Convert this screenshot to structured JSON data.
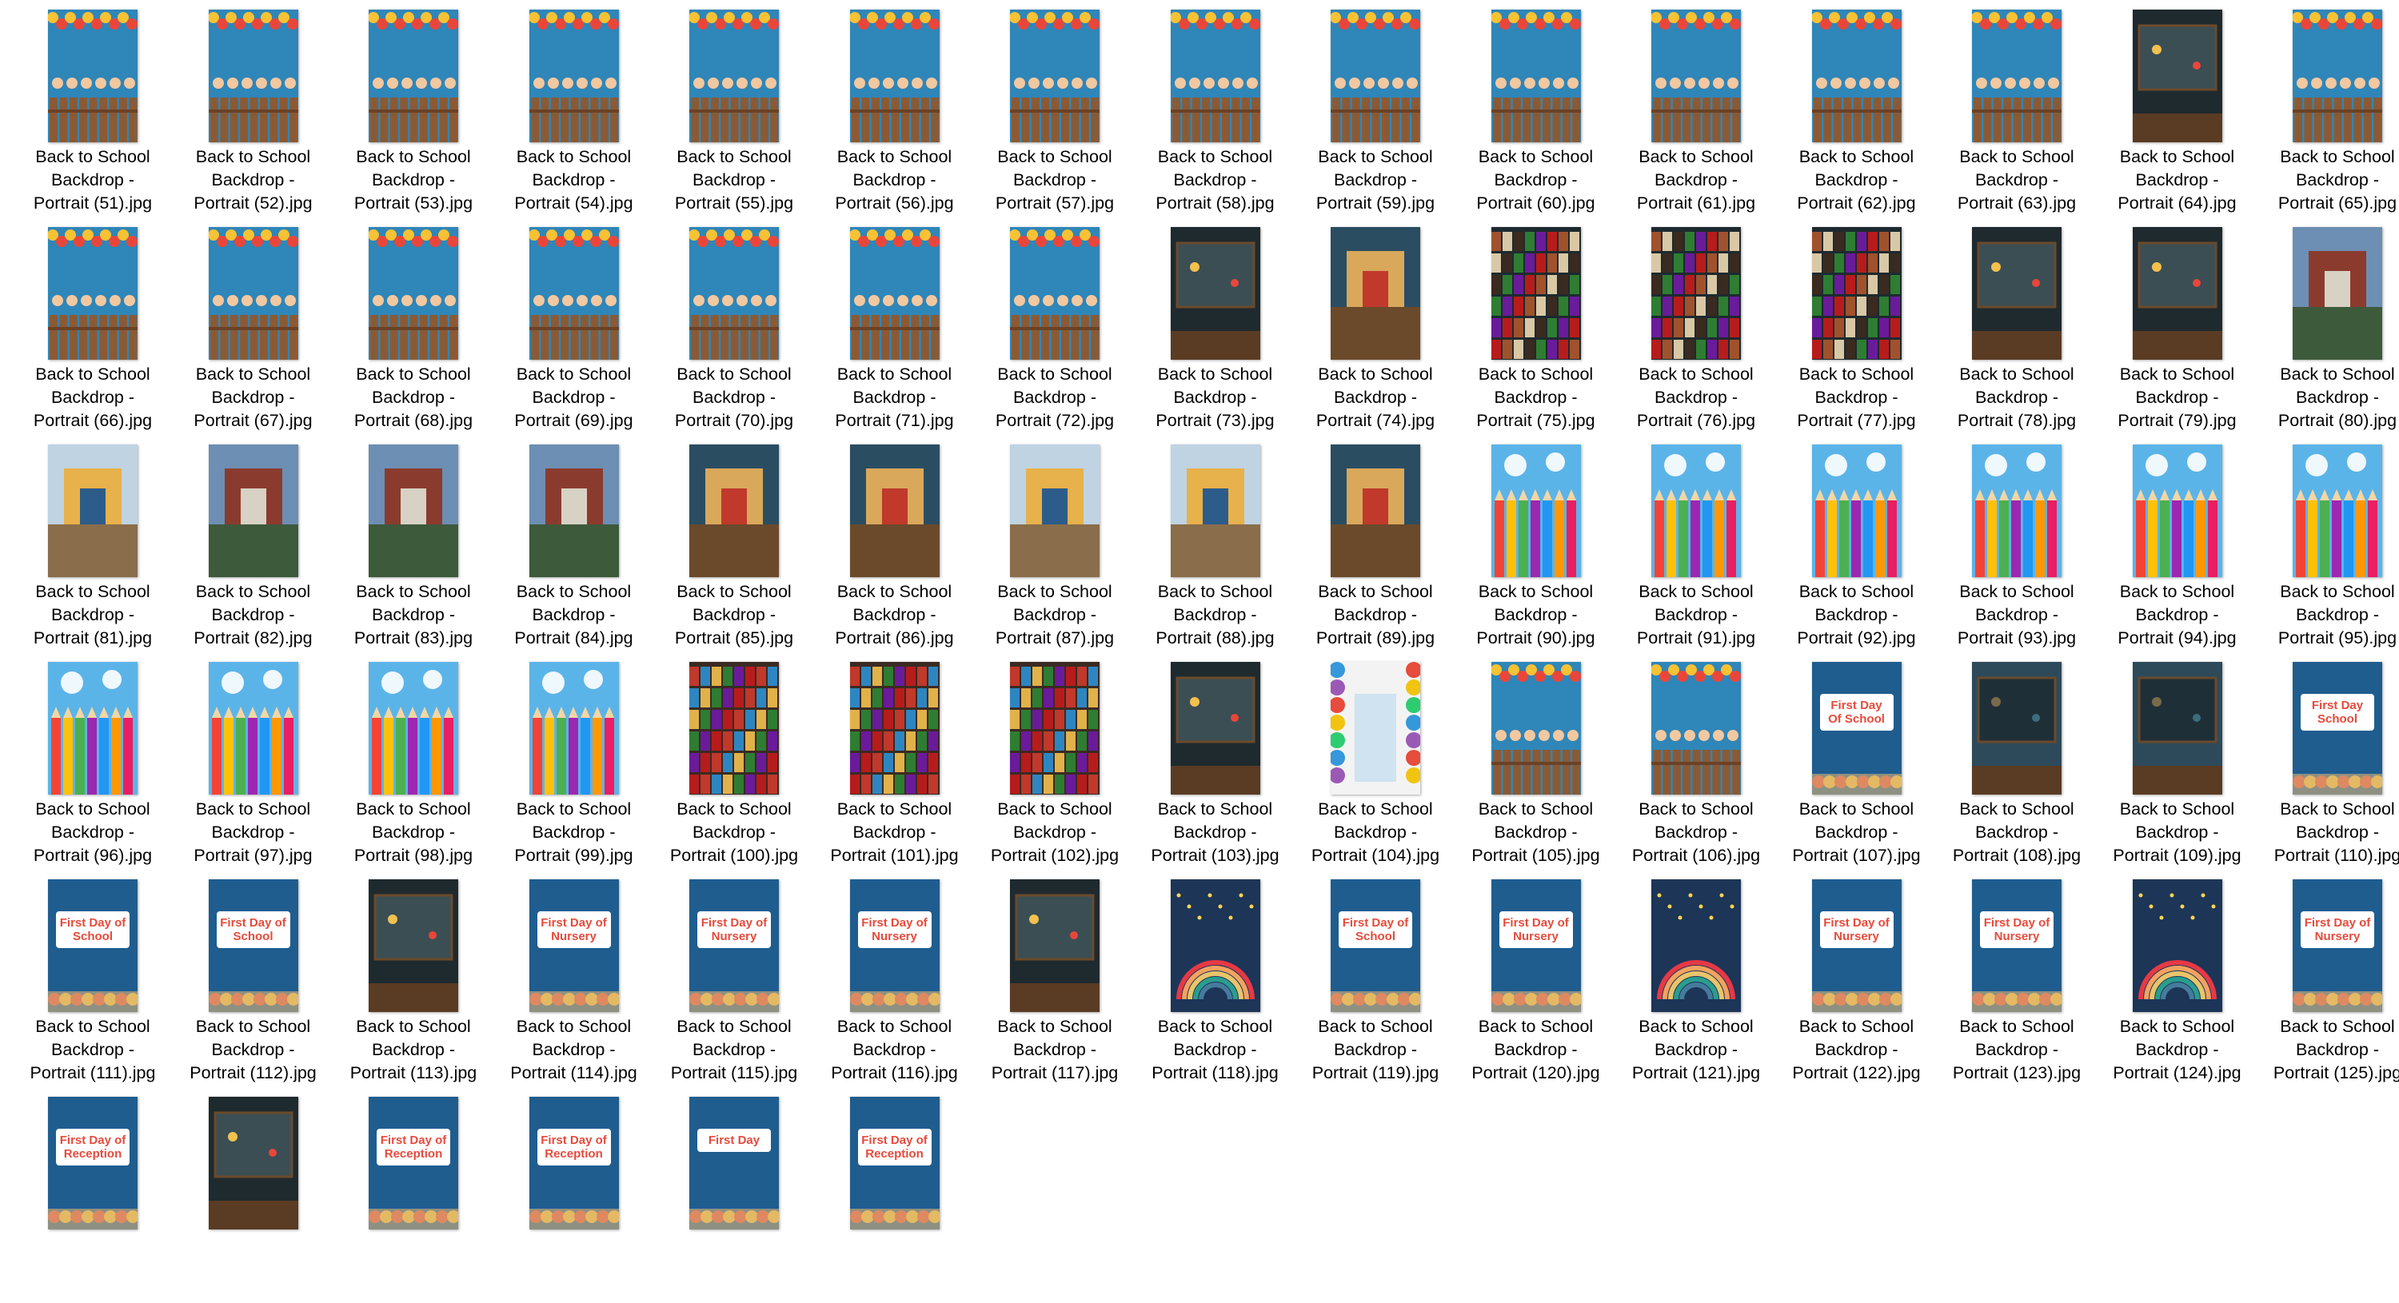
{
  "explorer": {
    "view": "large-icons"
  },
  "files": [
    {
      "label": "Back to School\nBackdrop -\nPortrait (51).jpg",
      "theme": "fence"
    },
    {
      "label": "Back to School\nBackdrop -\nPortrait (52).jpg",
      "theme": "fence"
    },
    {
      "label": "Back to School\nBackdrop -\nPortrait (53).jpg",
      "theme": "fence"
    },
    {
      "label": "Back to School\nBackdrop -\nPortrait (54).jpg",
      "theme": "fence"
    },
    {
      "label": "Back to School\nBackdrop -\nPortrait (55).jpg",
      "theme": "fence"
    },
    {
      "label": "Back to School\nBackdrop -\nPortrait (56).jpg",
      "theme": "fence"
    },
    {
      "label": "Back to School\nBackdrop -\nPortrait (57).jpg",
      "theme": "fence"
    },
    {
      "label": "Back to School\nBackdrop -\nPortrait (58).jpg",
      "theme": "fence"
    },
    {
      "label": "Back to School\nBackdrop -\nPortrait (59).jpg",
      "theme": "fence"
    },
    {
      "label": "Back to School\nBackdrop -\nPortrait (60).jpg",
      "theme": "fence"
    },
    {
      "label": "Back to School\nBackdrop -\nPortrait (61).jpg",
      "theme": "fence"
    },
    {
      "label": "Back to School\nBackdrop -\nPortrait (62).jpg",
      "theme": "fence"
    },
    {
      "label": "Back to School\nBackdrop -\nPortrait (63).jpg",
      "theme": "fence"
    },
    {
      "label": "Back to School\nBackdrop -\nPortrait (64).jpg",
      "theme": "chalkboard"
    },
    {
      "label": "Back to School\nBackdrop -\nPortrait (65).jpg",
      "theme": "fence"
    },
    {
      "label": "Back to School\nBackdrop -\nPortrait (66).jpg",
      "theme": "fence"
    },
    {
      "label": "Back to School\nBackdrop -\nPortrait (67).jpg",
      "theme": "fence"
    },
    {
      "label": "Back to School\nBackdrop -\nPortrait (68).jpg",
      "theme": "fence"
    },
    {
      "label": "Back to School\nBackdrop -\nPortrait (69).jpg",
      "theme": "fence"
    },
    {
      "label": "Back to School\nBackdrop -\nPortrait (70).jpg",
      "theme": "fence"
    },
    {
      "label": "Back to School\nBackdrop -\nPortrait (71).jpg",
      "theme": "fence"
    },
    {
      "label": "Back to School\nBackdrop -\nPortrait (72).jpg",
      "theme": "fence"
    },
    {
      "label": "Back to School\nBackdrop -\nPortrait (73).jpg",
      "theme": "chalkboard"
    },
    {
      "label": "Back to School\nBackdrop -\nPortrait (74).jpg",
      "theme": "classroom"
    },
    {
      "label": "Back to School\nBackdrop -\nPortrait (75).jpg",
      "theme": "books-dark"
    },
    {
      "label": "Back to School\nBackdrop -\nPortrait (76).jpg",
      "theme": "books-dark"
    },
    {
      "label": "Back to School\nBackdrop -\nPortrait (77).jpg",
      "theme": "books-dark"
    },
    {
      "label": "Back to School\nBackdrop -\nPortrait (78).jpg",
      "theme": "chalkboard"
    },
    {
      "label": "Back to School\nBackdrop -\nPortrait (79).jpg",
      "theme": "chalkboard"
    },
    {
      "label": "Back to School\nBackdrop -\nPortrait (80).jpg",
      "theme": "building"
    },
    {
      "label": "Back to School\nBackdrop -\nPortrait (81).jpg",
      "theme": "hallway"
    },
    {
      "label": "Back to School\nBackdrop -\nPortrait (82).jpg",
      "theme": "building"
    },
    {
      "label": "Back to School\nBackdrop -\nPortrait (83).jpg",
      "theme": "building"
    },
    {
      "label": "Back to School\nBackdrop -\nPortrait (84).jpg",
      "theme": "building"
    },
    {
      "label": "Back to School\nBackdrop -\nPortrait (85).jpg",
      "theme": "classroom"
    },
    {
      "label": "Back to School\nBackdrop -\nPortrait (86).jpg",
      "theme": "classroom"
    },
    {
      "label": "Back to School\nBackdrop -\nPortrait (87).jpg",
      "theme": "hallway"
    },
    {
      "label": "Back to School\nBackdrop -\nPortrait (88).jpg",
      "theme": "hallway"
    },
    {
      "label": "Back to School\nBackdrop -\nPortrait (89).jpg",
      "theme": "classroom"
    },
    {
      "label": "Back to School\nBackdrop -\nPortrait (90).jpg",
      "theme": "pencils"
    },
    {
      "label": "Back to School\nBackdrop -\nPortrait (91).jpg",
      "theme": "pencils"
    },
    {
      "label": "Back to School\nBackdrop -\nPortrait (92).jpg",
      "theme": "pencils"
    },
    {
      "label": "Back to School\nBackdrop -\nPortrait (93).jpg",
      "theme": "pencils"
    },
    {
      "label": "Back to School\nBackdrop -\nPortrait (94).jpg",
      "theme": "pencils"
    },
    {
      "label": "Back to School\nBackdrop -\nPortrait (95).jpg",
      "theme": "pencils"
    },
    {
      "label": "Back to School\nBackdrop -\nPortrait (96).jpg",
      "theme": "pencils"
    },
    {
      "label": "Back to School\nBackdrop -\nPortrait (97).jpg",
      "theme": "pencils"
    },
    {
      "label": "Back to School\nBackdrop -\nPortrait (98).jpg",
      "theme": "pencils"
    },
    {
      "label": "Back to School\nBackdrop -\nPortrait (99).jpg",
      "theme": "pencils"
    },
    {
      "label": "Back to School\nBackdrop -\nPortrait (100).jpg",
      "theme": "books"
    },
    {
      "label": "Back to School\nBackdrop -\nPortrait (101).jpg",
      "theme": "books"
    },
    {
      "label": "Back to School\nBackdrop -\nPortrait (102).jpg",
      "theme": "books"
    },
    {
      "label": "Back to School\nBackdrop -\nPortrait (103).jpg",
      "theme": "chalkboard"
    },
    {
      "label": "Back to School\nBackdrop -\nPortrait (104).jpg",
      "theme": "balloons"
    },
    {
      "label": "Back to School\nBackdrop -\nPortrait (105).jpg",
      "theme": "fence"
    },
    {
      "label": "Back to School\nBackdrop -\nPortrait (106).jpg",
      "theme": "fence"
    },
    {
      "label": "Back to School\nBackdrop -\nPortrait (107).jpg",
      "theme": "sign",
      "text": "First Day Of School"
    },
    {
      "label": "Back to School\nBackdrop -\nPortrait (108).jpg",
      "theme": "map"
    },
    {
      "label": "Back to School\nBackdrop -\nPortrait (109).jpg",
      "theme": "map"
    },
    {
      "label": "Back to School\nBackdrop -\nPortrait (110).jpg",
      "theme": "sign",
      "text": "First Day School"
    },
    {
      "label": "Back to School\nBackdrop -\nPortrait (111).jpg",
      "theme": "sign",
      "text": "First Day of School"
    },
    {
      "label": "Back to School\nBackdrop -\nPortrait (112).jpg",
      "theme": "sign",
      "text": "First Day of School"
    },
    {
      "label": "Back to School\nBackdrop -\nPortrait (113).jpg",
      "theme": "chalkboard"
    },
    {
      "label": "Back to School\nBackdrop -\nPortrait (114).jpg",
      "theme": "sign",
      "text": "First Day of Nursery"
    },
    {
      "label": "Back to School\nBackdrop -\nPortrait (115).jpg",
      "theme": "sign",
      "text": "First Day of Nursery"
    },
    {
      "label": "Back to School\nBackdrop -\nPortrait (116).jpg",
      "theme": "sign",
      "text": "First Day of Nursery"
    },
    {
      "label": "Back to School\nBackdrop -\nPortrait (117).jpg",
      "theme": "chalkboard"
    },
    {
      "label": "Back to School\nBackdrop -\nPortrait (118).jpg",
      "theme": "rainbow"
    },
    {
      "label": "Back to School\nBackdrop -\nPortrait (119).jpg",
      "theme": "sign",
      "text": "First Day of School"
    },
    {
      "label": "Back to School\nBackdrop -\nPortrait (120).jpg",
      "theme": "sign",
      "text": "First Day of Nursery"
    },
    {
      "label": "Back to School\nBackdrop -\nPortrait (121).jpg",
      "theme": "rainbow"
    },
    {
      "label": "Back to School\nBackdrop -\nPortrait (122).jpg",
      "theme": "sign",
      "text": "First Day of Nursery"
    },
    {
      "label": "Back to School\nBackdrop -\nPortrait (123).jpg",
      "theme": "sign",
      "text": "First Day of Nursery"
    },
    {
      "label": "Back to School\nBackdrop -\nPortrait (124).jpg",
      "theme": "rainbow"
    },
    {
      "label": "Back to School\nBackdrop -\nPortrait (125).jpg",
      "theme": "sign",
      "text": "First Day of Nursery"
    },
    {
      "label": "",
      "theme": "sign",
      "text": "First Day of Reception"
    },
    {
      "label": "",
      "theme": "chalkboard"
    },
    {
      "label": "",
      "theme": "sign",
      "text": "First Day of Reception"
    },
    {
      "label": "",
      "theme": "sign",
      "text": "First Day of Reception"
    },
    {
      "label": "",
      "theme": "sign",
      "text": "First Day"
    },
    {
      "label": "",
      "theme": "sign",
      "text": "First Day of Reception"
    }
  ]
}
